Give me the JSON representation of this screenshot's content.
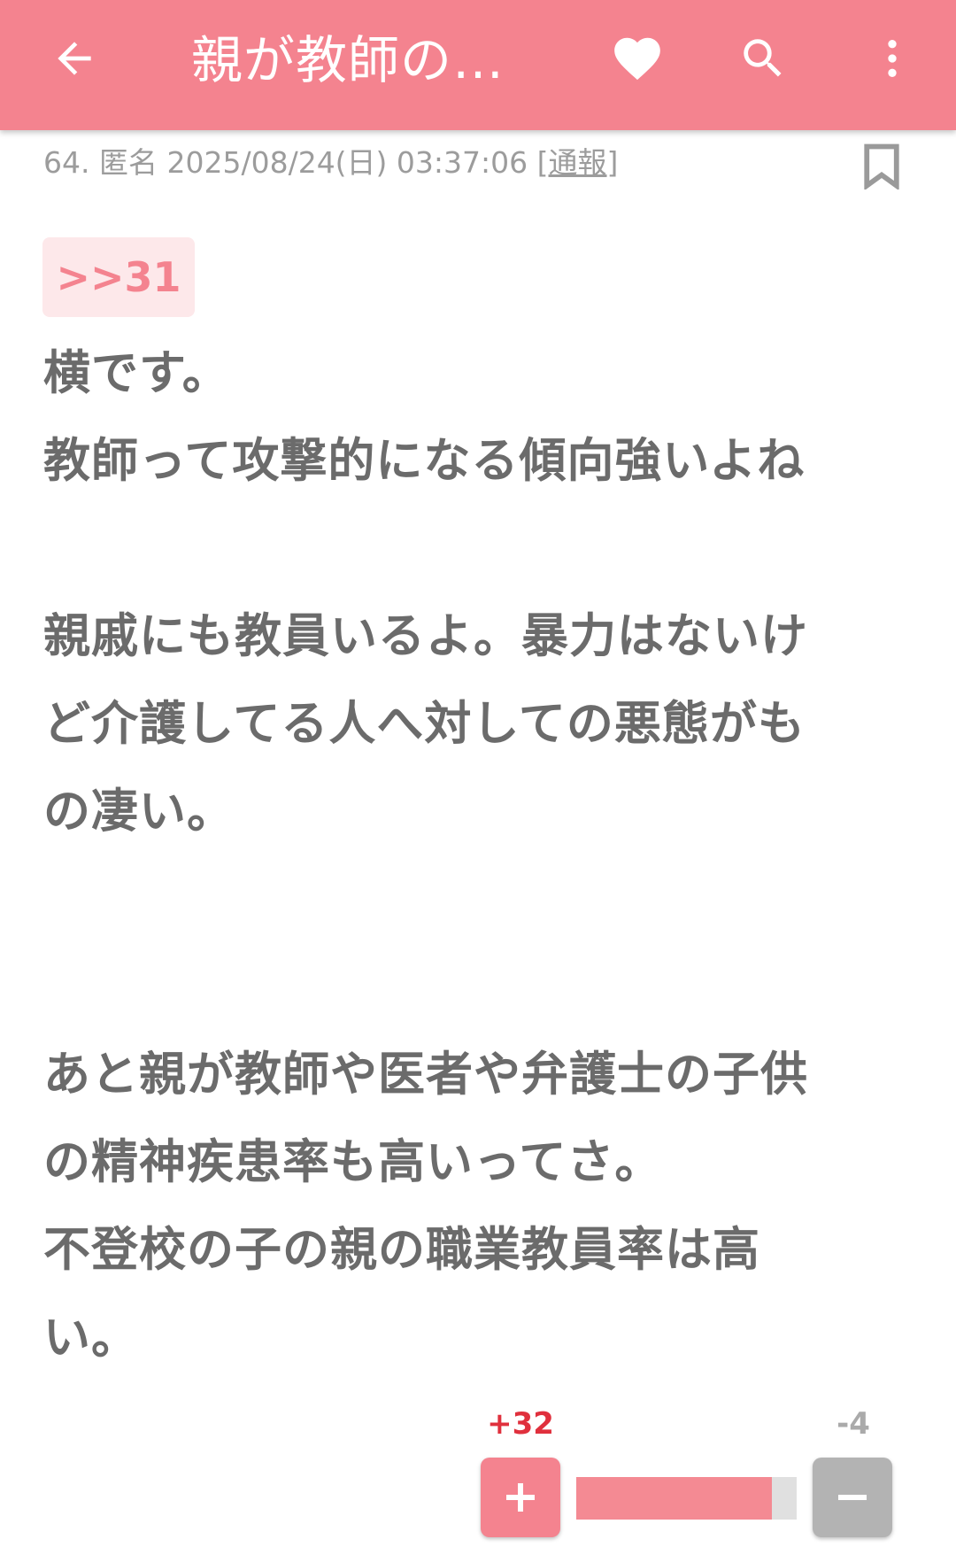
{
  "app_bar": {
    "title": "親が教師の方...",
    "background_color": "#f4838f",
    "icons": [
      "back-arrow-icon",
      "heart-icon",
      "search-icon",
      "more-vertical-icon"
    ]
  },
  "comment": {
    "number": "64.",
    "author": "匿名",
    "timestamp": "2025/08/24(日) 03:37:06",
    "report_open": "[",
    "report_label": "通報",
    "report_close": "]",
    "anchor": ">>31",
    "body_lines": [
      "横です。",
      "教師って攻撃的になる傾向強いよね",
      "",
      "親戚にも教員いるよ。暴力はないけ",
      "ど介護してる人へ対しての悪態がも",
      "の凄い。",
      "",
      "",
      "あと親が教師や医者や弁護士の子供",
      "の精神疾患率も高いってさ。",
      "不登校の子の親の職業教員率は高",
      "い。"
    ]
  },
  "votes": {
    "plus_label": "+32",
    "minus_label": "-4",
    "plus": 32,
    "minus": 4,
    "plus_color": "#e0303d",
    "bar_color": "#f48a93"
  }
}
